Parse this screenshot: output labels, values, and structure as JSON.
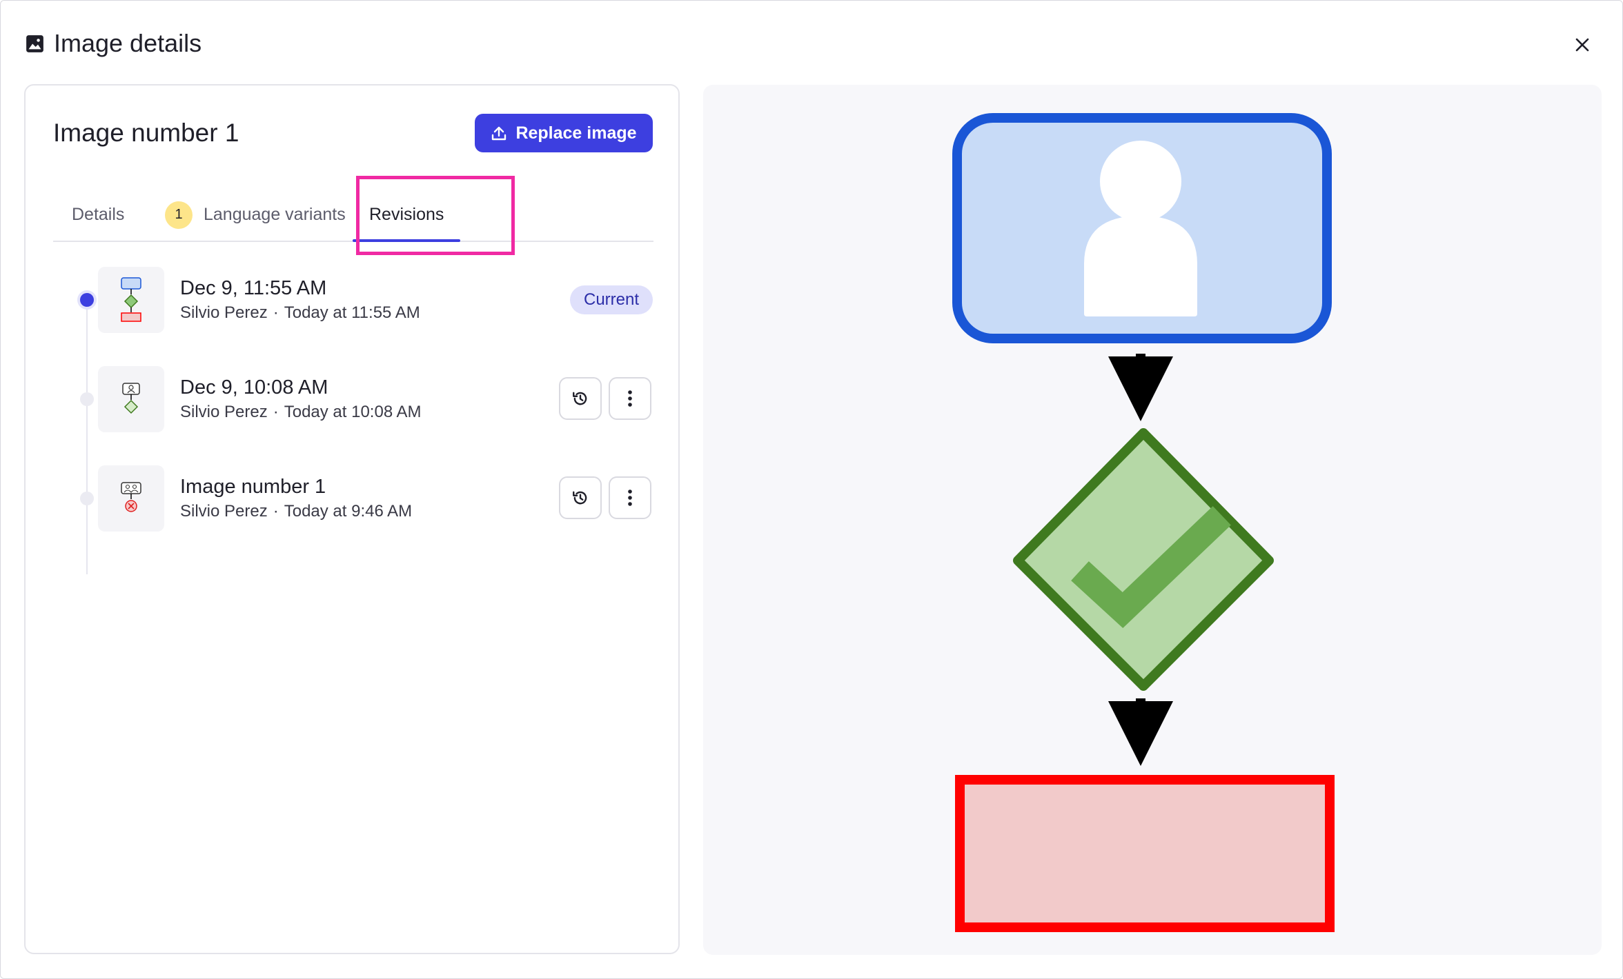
{
  "dialog": {
    "title": "Image details",
    "icon": "image-icon",
    "close_icon": "close-icon"
  },
  "panel": {
    "heading": "Image number 1",
    "replace_label": "Replace image",
    "replace_icon": "upload-icon"
  },
  "tabs": [
    {
      "label": "Details",
      "active": false
    },
    {
      "label": "Language variants",
      "badge": "1",
      "active": false
    },
    {
      "label": "Revisions",
      "active": true
    }
  ],
  "revisions": [
    {
      "title": "Dec 9, 11:55 AM",
      "author": "Silvio Perez",
      "sep": "·",
      "time": "Today at 11:55 AM",
      "badge": "Current"
    },
    {
      "title": "Dec 9, 10:08 AM",
      "author": "Silvio Perez",
      "sep": "·",
      "time": "Today at 10:08 AM",
      "restore_icon": "history-icon",
      "more_icon": "more-vertical-icon"
    },
    {
      "title": "Image number 1",
      "author": "Silvio Perez",
      "sep": "·",
      "time": "Today at 9:46 AM",
      "restore_icon": "history-icon",
      "more_icon": "more-vertical-icon"
    }
  ],
  "colors": {
    "accent": "#3d3fe0",
    "highlight": "#f02aa3",
    "person_box_stroke": "#1a56d6",
    "person_box_fill": "#c8dbf7",
    "diamond_stroke": "#3f7a1f",
    "diamond_fill": "#b5d8a6",
    "check": "#6aaa4f",
    "end_box_stroke": "#ff0000",
    "end_box_fill": "#f2caca"
  }
}
